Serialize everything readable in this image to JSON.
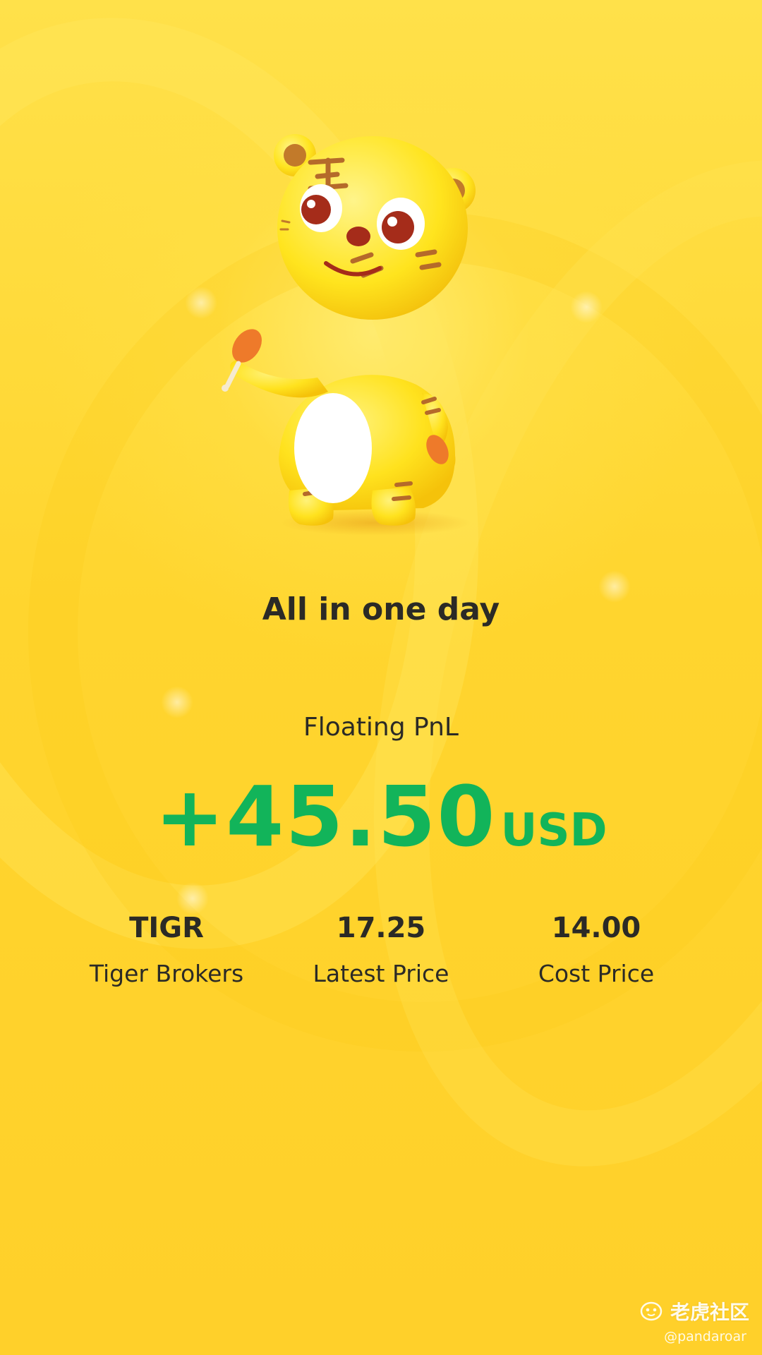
{
  "headline": "All in one day",
  "pnl": {
    "label": "Floating PnL",
    "amount": "+45.50",
    "unit": "USD",
    "color": "#12b45a"
  },
  "stats": [
    {
      "value": "TIGR",
      "label": "Tiger Brokers"
    },
    {
      "value": "17.25",
      "label": "Latest Price"
    },
    {
      "value": "14.00",
      "label": "Cost Price"
    }
  ],
  "watermark": {
    "brand": "老虎社区",
    "handle": "@pandaroar",
    "icon": "tiger-community-logo"
  },
  "colors": {
    "background": "#ffd52e",
    "text": "#2b2a26",
    "mascot_body": "#ffe12a",
    "mascot_stripes": "#b56a2a"
  }
}
